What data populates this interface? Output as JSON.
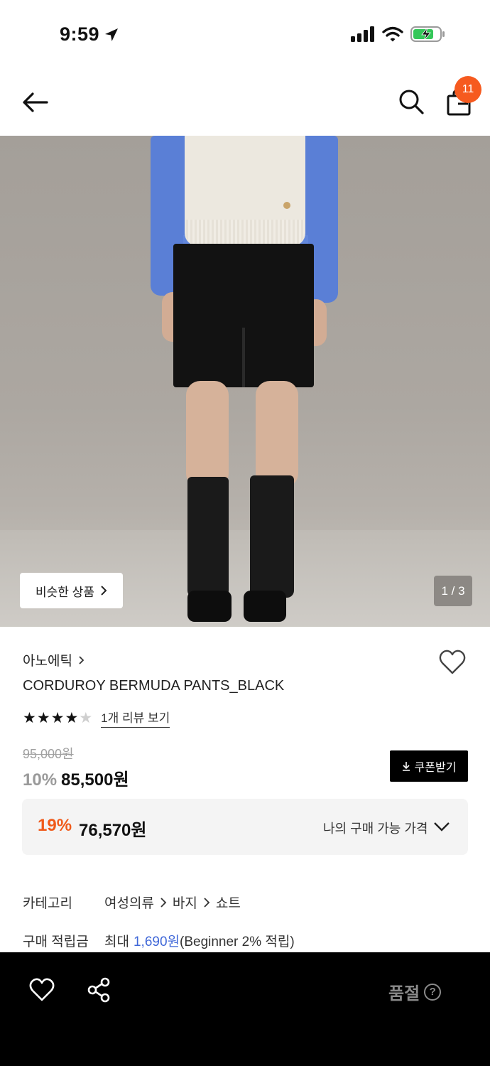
{
  "status_bar": {
    "time": "9:59"
  },
  "header": {
    "cart_count": "11"
  },
  "gallery": {
    "similar_label": "비슷한 상품",
    "counter": "1 / 3"
  },
  "product": {
    "brand": "아노에틱",
    "name": "CORDUROY BERMUDA PANTS_BLACK",
    "rating": 4,
    "rating_max": 5,
    "review_link": "1개 리뷰 보기",
    "original_price": "95,000원",
    "discount": "10%",
    "price": "85,500원",
    "coupon_label": "쿠폰받기"
  },
  "my_price": {
    "discount": "19%",
    "price": "76,570원",
    "label": "나의 구매 가능 가격"
  },
  "info": {
    "category_label": "카테고리",
    "categories": [
      "여성의류",
      "바지",
      "쇼트"
    ],
    "points_label": "구매 적립금",
    "points_prefix": "최대",
    "points_amount": "1,690원",
    "points_suffix": "(Beginner 2% 적립)"
  },
  "bottom_bar": {
    "status_label": "품절",
    "help_symbol": "?"
  },
  "colors": {
    "accent": "#3f67d8",
    "discount_orange": "#f05a1a",
    "badge": "#f65a1f"
  }
}
